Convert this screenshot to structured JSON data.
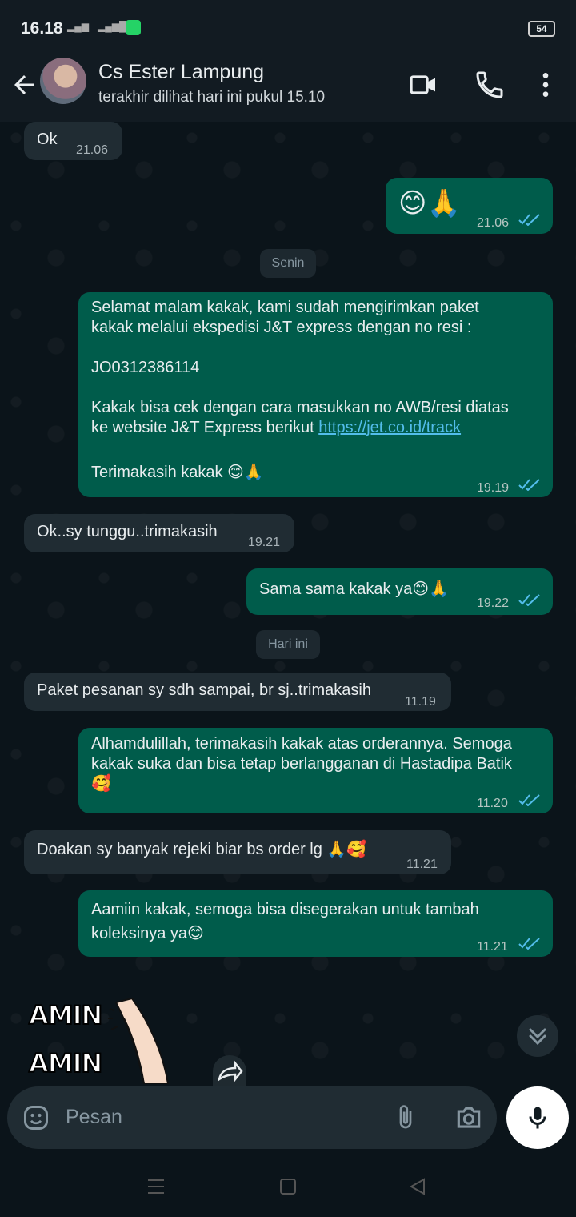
{
  "status_bar": {
    "time": "16.18",
    "battery": "54"
  },
  "header": {
    "name": "Cs Ester Lampung",
    "status": "terakhir dilihat hari ini pukul 15.10"
  },
  "messages": [
    {
      "dir": "in",
      "text": "Ok",
      "time": "21.06"
    },
    {
      "dir": "out",
      "text": "😊🙏",
      "time": "21.06"
    },
    {
      "dir": "sep",
      "text": "Senin"
    },
    {
      "dir": "out",
      "text_a": "Selamat malam kakak, kami sudah mengirimkan paket\nkakak melalui ekspedisi J&T express dengan no resi :\n\nJO0312386114\n\nKakak bisa cek dengan cara masukkan no AWB/resi diatas\nke website J&T Express berikut ",
      "link": "https://jet.co.id/track",
      "text_b": "Terimakasih kakak 😊🙏",
      "time": "19.19"
    },
    {
      "dir": "in",
      "text": "Ok..sy tunggu..trimakasih",
      "time": "19.21"
    },
    {
      "dir": "out",
      "text": "Sama sama kakak ya😊🙏",
      "time": "19.22"
    },
    {
      "dir": "sep",
      "text": "Hari ini"
    },
    {
      "dir": "in",
      "text": "Paket pesanan sy sdh sampai, br sj..trimakasih",
      "time": "11.19"
    },
    {
      "dir": "out",
      "text": "Alhamdulillah, terimakasih kakak atas orderannya. Semoga\nkakak suka dan bisa tetap berlangganan di Hastadipa Batik\n🥰",
      "time": "11.20"
    },
    {
      "dir": "in",
      "text": "Doakan sy banyak rejeki biar bs order lg 🙏🥰",
      "time": "11.21"
    },
    {
      "dir": "out",
      "text": "Aamiin kakak, semoga bisa disegerakan untuk tambah\nkoleksinya ya😊",
      "time": "11.21"
    }
  ],
  "sticker": {
    "line1": "AMIN",
    "line2": "AMIN"
  },
  "composer": {
    "placeholder": "Pesan"
  },
  "colors": {
    "incoming": "#202c33",
    "outgoing": "#005c4b",
    "read_ticks": "#53bdeb"
  },
  "icons": [
    "back-arrow-icon",
    "video-call-icon",
    "phone-icon",
    "more-vert-icon",
    "emoji-sticker-icon",
    "attach-icon",
    "camera-icon",
    "mic-icon",
    "scroll-down-icon",
    "forward-icon"
  ]
}
